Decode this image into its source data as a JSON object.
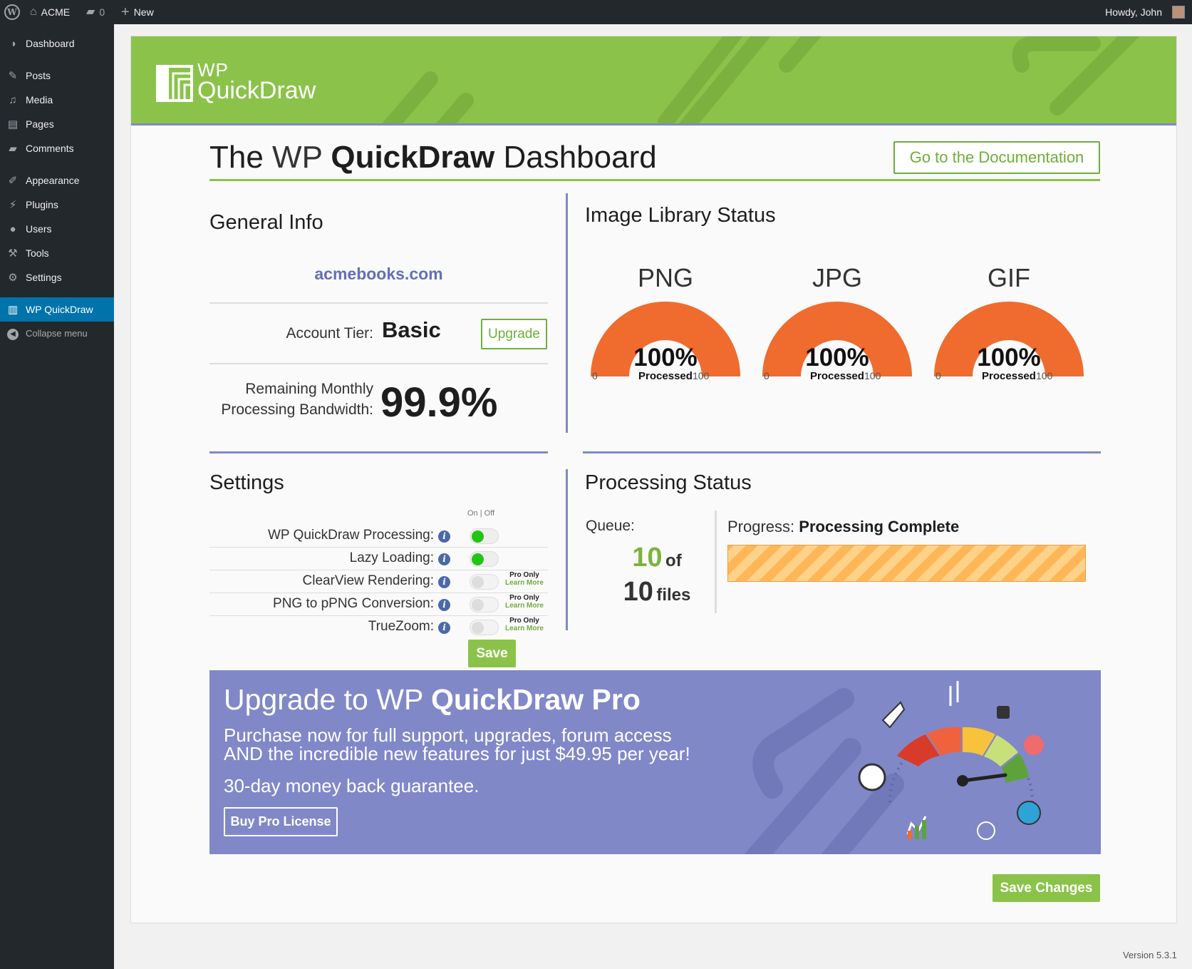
{
  "adminbar": {
    "site_name": "ACME",
    "comments_count": "0",
    "new_label": "New",
    "howdy": "Howdy, John"
  },
  "sidebar": {
    "items": [
      {
        "label": "Dashboard",
        "icon": "dashboard-icon"
      },
      {
        "label": "Posts",
        "icon": "pin-icon"
      },
      {
        "label": "Media",
        "icon": "media-icon"
      },
      {
        "label": "Pages",
        "icon": "pages-icon"
      },
      {
        "label": "Comments",
        "icon": "comment-icon"
      },
      {
        "label": "Appearance",
        "icon": "brush-icon"
      },
      {
        "label": "Plugins",
        "icon": "plug-icon"
      },
      {
        "label": "Users",
        "icon": "user-icon"
      },
      {
        "label": "Tools",
        "icon": "wrench-icon"
      },
      {
        "label": "Settings",
        "icon": "settings-icon"
      },
      {
        "label": "WP QuickDraw",
        "icon": "quickdraw-icon",
        "active": true
      },
      {
        "label": "Collapse menu",
        "icon": "collapse-icon"
      }
    ]
  },
  "banner": {
    "logo_wp": "WP",
    "logo_name": "QuickDraw"
  },
  "header": {
    "title_pre": "The ",
    "title_wp": "WP ",
    "title_brand": "QuickDraw",
    "title_post": " Dashboard",
    "doc_button": "Go to the Documentation"
  },
  "general_info": {
    "heading": "General Info",
    "site": "acmebooks.com",
    "tier_label": "Account Tier:",
    "tier_value": "Basic",
    "upgrade_button": "Upgrade",
    "bandwidth_label_1": "Remaining Monthly",
    "bandwidth_label_2": "Processing Bandwidth:",
    "bandwidth_value": "99.9%"
  },
  "image_library": {
    "heading": "Image Library Status",
    "gauges": [
      {
        "label": "PNG",
        "percent": "100%",
        "sub": "Processed",
        "min": "0",
        "max": "100",
        "value": 100
      },
      {
        "label": "JPG",
        "percent": "100%",
        "sub": "Processed",
        "min": "0",
        "max": "100",
        "value": 100
      },
      {
        "label": "GIF",
        "percent": "100%",
        "sub": "Processed",
        "min": "0",
        "max": "100",
        "value": 100
      }
    ]
  },
  "settings": {
    "heading": "Settings",
    "on_off": "On | Off",
    "rows": [
      {
        "label": "WP QuickDraw Processing:",
        "state": "on"
      },
      {
        "label": "Lazy Loading:",
        "state": "on"
      },
      {
        "label": "ClearView Rendering:",
        "state": "pro"
      },
      {
        "label": "PNG to pPNG Conversion:",
        "state": "pro"
      },
      {
        "label": "TrueZoom:",
        "state": "pro"
      }
    ],
    "pro_only": "Pro Only",
    "learn_more": "Learn More",
    "save_button": "Save"
  },
  "processing": {
    "heading": "Processing Status",
    "queue_label": "Queue:",
    "queue_done": "10",
    "of": "of",
    "queue_total": "10",
    "files": "files",
    "progress_label": "Progress:",
    "progress_status": "Processing Complete",
    "progress_fraction": 1.0
  },
  "promo": {
    "title_pre": "Upgrade to ",
    "title_wp": "WP ",
    "title_brand": "QuickDraw Pro",
    "text_1": "Purchase now for full support, upgrades, forum access",
    "text_2": "AND the incredible new features for just $49.95 per year!",
    "guarantee": "30-day money back guarantee.",
    "buy_button": "Buy Pro License"
  },
  "footer": {
    "save_changes": "Save Changes",
    "version": "Version 5.3.1"
  },
  "colors": {
    "brand_green": "#8bc34a",
    "accent_purple": "#7f89c9",
    "gauge_orange": "#f06b2e",
    "wp_blue": "#0073aa"
  }
}
